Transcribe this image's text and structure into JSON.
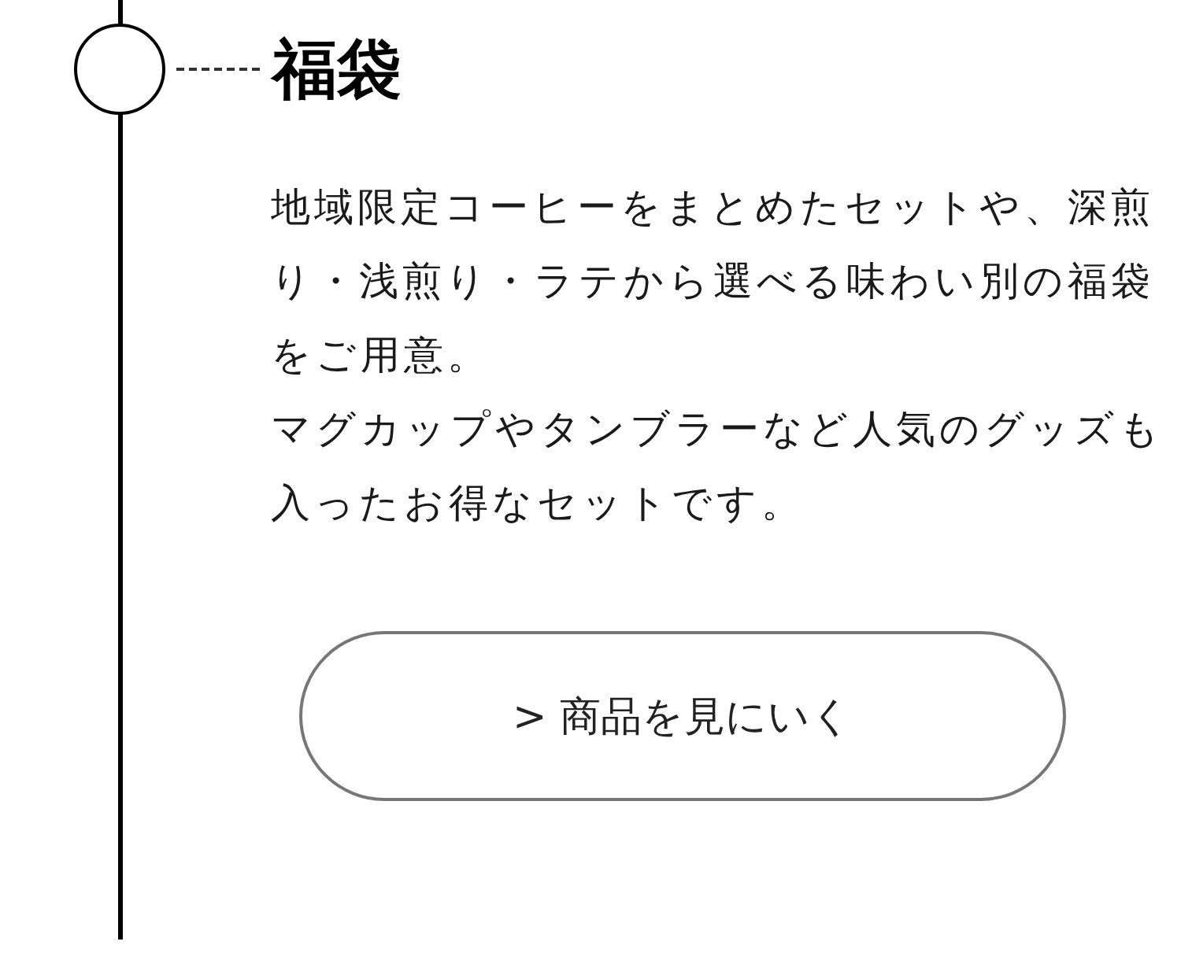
{
  "section": {
    "title": "福袋",
    "paragraphs": [
      "地域限定コーヒーをまとめたセットや、深煎り・浅煎り・ラテから選べる味わい別の福袋をご用意。",
      "マグカップやタンブラーなど人気のグッズも入ったお得なセットです。"
    ],
    "button": {
      "label": "> 商品を見にいく"
    }
  }
}
